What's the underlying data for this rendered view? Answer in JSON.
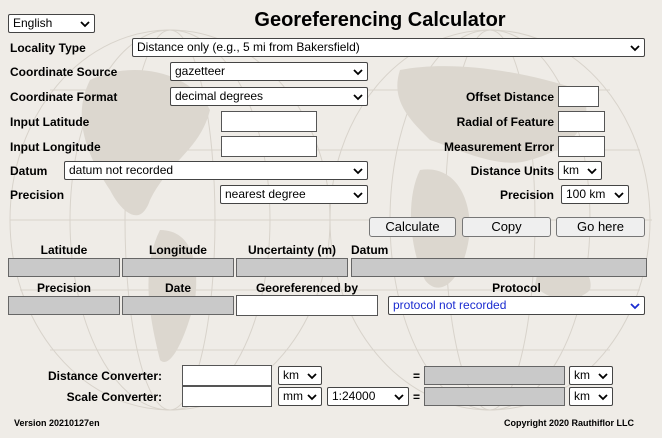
{
  "title": "Georeferencing Calculator",
  "language": "English",
  "labels": {
    "locality_type": "Locality Type",
    "coordinate_source": "Coordinate Source",
    "coordinate_format": "Coordinate Format",
    "input_latitude": "Input Latitude",
    "input_longitude": "Input Longitude",
    "datum": "Datum",
    "precision": "Precision",
    "offset_distance": "Offset Distance",
    "radial_of_feature": "Radial of Feature",
    "measurement_error": "Measurement Error",
    "distance_units": "Distance Units",
    "precision_right": "Precision"
  },
  "selects": {
    "locality_type": "Distance only (e.g., 5 mi from Bakersfield)",
    "coordinate_source": "gazetteer",
    "coordinate_format": "decimal degrees",
    "datum": "datum not recorded",
    "precision": "nearest degree",
    "distance_units": "km",
    "precision_right": "100 km",
    "protocol": "protocol not recorded",
    "converter_units_left": "km",
    "converter_units_right": "km",
    "scale_units_left": "mm",
    "scale_ratio": "1:24000",
    "scale_units_right": "km"
  },
  "buttons": {
    "calculate": "Calculate",
    "copy": "Copy",
    "go_here": "Go here"
  },
  "results": {
    "latitude": "Latitude",
    "longitude": "Longitude",
    "uncertainty": "Uncertainty (m)",
    "datum": "Datum",
    "precision": "Precision",
    "date": "Date",
    "georeferenced_by": "Georeferenced by",
    "protocol": "Protocol"
  },
  "converters": {
    "distance": "Distance Converter:",
    "scale": "Scale Converter:",
    "equals": "="
  },
  "footer": {
    "version": "Version 20210127en",
    "copyright": "Copyright 2020 Rauthiflor LLC"
  },
  "colors": {
    "output_fill": "#c9c9c9",
    "protocol_text": "#1a2bd0"
  }
}
